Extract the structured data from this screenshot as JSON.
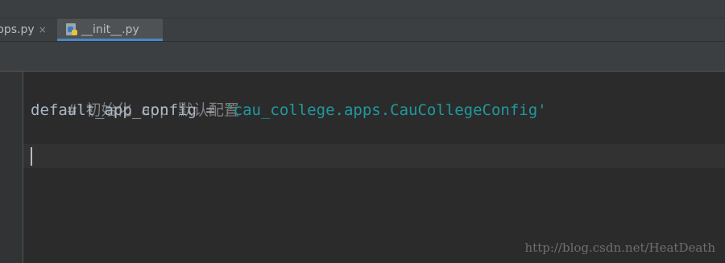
{
  "tabs": [
    {
      "label": "pps.py",
      "close": "×",
      "active": false
    },
    {
      "label": "__init__.py",
      "close": "",
      "active": true,
      "icon": "python-file-icon"
    }
  ],
  "code": {
    "line1_comment": "# 初始化 app 默认配置",
    "line2_identifier": "default_app_config",
    "line2_operator": " = ",
    "line2_string": "'cau_college.apps.CauCollegeConfig'"
  },
  "watermark": "http://blog.csdn.net/HeatDeath",
  "colors": {
    "background": "#2b2b2b",
    "comment": "#808080",
    "identifier": "#a9b7c6",
    "string": "#20999d",
    "tab_underline": "#4a88c7"
  }
}
